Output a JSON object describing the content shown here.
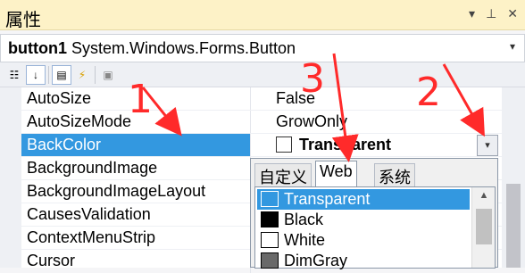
{
  "window": {
    "title": "属性",
    "title_icons": [
      "dropdown-arrow-icon",
      "pin-icon",
      "close-icon"
    ]
  },
  "object_selector": {
    "name": "button1",
    "type": "System.Windows.Forms.Button"
  },
  "toolbar": {
    "buttons": [
      "categorized-icon",
      "alphabetical-icon",
      "properties-icon",
      "events-icon",
      "property-pages-icon"
    ]
  },
  "properties": [
    {
      "name": "AutoSize",
      "value": "False"
    },
    {
      "name": "AutoSizeMode",
      "value": "GrowOnly"
    },
    {
      "name": "BackColor",
      "value": "Transparent",
      "selected": true
    },
    {
      "name": "BackgroundImage",
      "value": ""
    },
    {
      "name": "BackgroundImageLayout",
      "value": ""
    },
    {
      "name": "CausesValidation",
      "value": ""
    },
    {
      "name": "ContextMenuStrip",
      "value": ""
    },
    {
      "name": "Cursor",
      "value": ""
    }
  ],
  "color_picker": {
    "tabs": [
      "自定义",
      "Web",
      "系统"
    ],
    "active_tab": "Web",
    "colors": [
      {
        "name": "Transparent",
        "color": "#3398e0",
        "selected": true
      },
      {
        "name": "Black",
        "color": "#000000"
      },
      {
        "name": "White",
        "color": "#ffffff"
      },
      {
        "name": "DimGray",
        "color": "#696969"
      }
    ]
  },
  "annotations": [
    "1",
    "2",
    "3"
  ],
  "colors": {
    "selection": "#3398e0",
    "title_bg": "#fdf2c7",
    "annotation": "#ff2a2a"
  }
}
